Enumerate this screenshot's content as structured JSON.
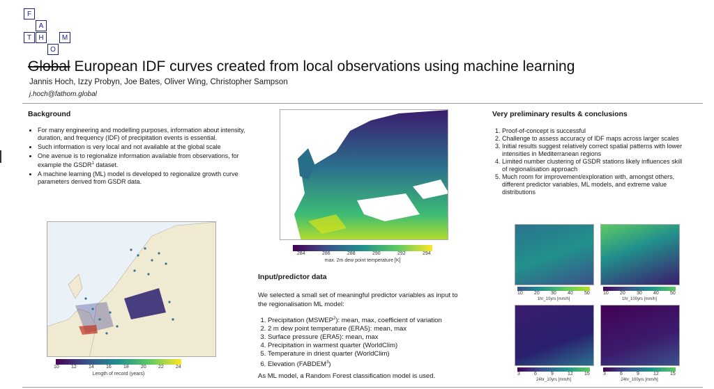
{
  "logo": {
    "letters": [
      "F",
      "A",
      "T",
      "H",
      "O",
      "M"
    ]
  },
  "title": {
    "struck": "Global",
    "rest": " European IDF curves created from local observations using machine learning"
  },
  "authors": "Jannis Hoch, Izzy Probyn, Joe Bates, Oliver Wing, Christopher Sampson",
  "email": "j.hoch@fathom.global",
  "background": {
    "heading": "Background",
    "bullets": [
      "For many engineering and modelling purposes, information about intensity, duration, and frequency (IDF) of precipitation events is essential.",
      "Such information is very local and not available at the global scale",
      "One avenue is to regionalize information available from observations, for example the GSDR",
      "A machine learning (ML) model is developed to regionalize growth curve parameters derived from GSDR data."
    ],
    "bullet3_sup": "1",
    "bullet3_tail": " dataset."
  },
  "input": {
    "heading": "Input/predictor data",
    "intro": "We selected a small set of meaningful predictor variables as input to the regionalisation ML model:",
    "items": [
      "Precipitation (MSWEP",
      "2 m dew point temperature (ERA5): mean, max",
      "Surface pressure (ERA5): mean, max",
      "Precipitation in warmest quarter (WorldClim)",
      "Temperature in driest quarter (WorldClim)",
      "Elevation (FABDEM"
    ],
    "item1_sup": "2",
    "item1_tail": "): mean, max, coefficient of variation",
    "item6_sup": "3",
    "item6_tail": ")",
    "note": "As ML model, a Random Forest classification model is used."
  },
  "results": {
    "heading": "Very preliminary results & conclusions",
    "items": [
      "Proof-of-concept is successful",
      "Challenge to assess accuracy of IDF maps across larger scales",
      "Initial results suggest relatively correct spatial patterns with lower intensities in Mediterranean regions",
      "Limited number clustering of GSDR stations likely influences skill of regionalisation approach",
      "Much room for improvement/exploration with, amongst others, different predictor variables, ML models, and extreme value distributions"
    ]
  },
  "maps": {
    "stations": {
      "ticks": [
        "10",
        "12",
        "14",
        "16",
        "18",
        "20",
        "22",
        "24"
      ],
      "label": "Length of record (years)"
    },
    "dewpoint": {
      "ticks": [
        "284",
        "286",
        "288",
        "290",
        "292",
        "294"
      ],
      "label": "max. 2m dew point temperature [K]"
    },
    "small": [
      {
        "ticks": [
          "10",
          "20",
          "30",
          "40",
          "50"
        ],
        "label": "1hr_10yrs [mm/h]"
      },
      {
        "ticks": [
          "10",
          "20",
          "30",
          "40",
          "50"
        ],
        "label": "1hr_100yrs [mm/h]"
      },
      {
        "ticks": [
          "3",
          "6",
          "9",
          "12",
          "15"
        ],
        "label": "24hr_10yrs [mm/h]"
      },
      {
        "ticks": [
          "3",
          "6",
          "9",
          "12",
          "15"
        ],
        "label": "24hr_100yrs [mm/h]"
      }
    ]
  },
  "colors": {
    "viridis_dark": "#440154",
    "viridis_mid": "#21918c",
    "viridis_light": "#fde725",
    "logo": "#1a1f8c"
  }
}
